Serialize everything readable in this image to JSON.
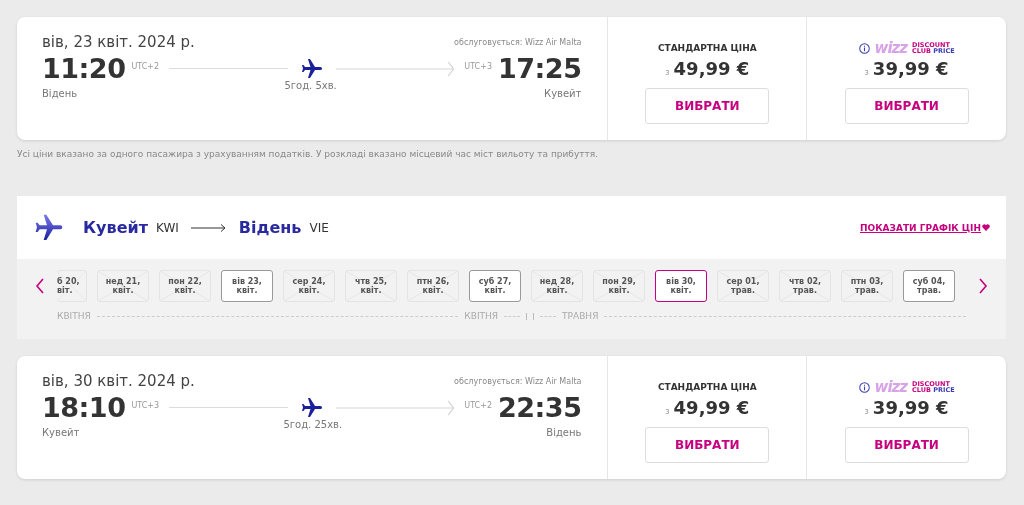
{
  "flights": [
    {
      "date": "вів, 23 квіт. 2024 р.",
      "operator": "обслуговується: Wizz Air Malta",
      "dep_time": "11:20",
      "dep_tz": "UTC+2",
      "dep_city": "Відень",
      "duration": "5год. 5хв.",
      "arr_tz": "UTC+3",
      "arr_time": "17:25",
      "arr_city": "Кувейт",
      "fares": [
        {
          "kind": "standard",
          "title": "СТАНДАРТНА ЦІНА",
          "from": "з",
          "price": "49,99 €",
          "button": "ВИБРАТИ"
        },
        {
          "kind": "club",
          "logo": "wizz",
          "title_1": "DISCOUNT",
          "title_2": "CLUB",
          "title_3": "PRICE",
          "from": "з",
          "price": "39,99 €",
          "button": "ВИБРАТИ"
        }
      ]
    },
    {
      "date": "вів, 30 квіт. 2024 р.",
      "operator": "обслуговується: Wizz Air Malta",
      "dep_time": "18:10",
      "dep_tz": "UTC+3",
      "dep_city": "Кувейт",
      "duration": "5год. 25хв.",
      "arr_tz": "UTC+2",
      "arr_time": "22:35",
      "arr_city": "Відень",
      "fares": [
        {
          "kind": "standard",
          "title": "СТАНДАРТНА ЦІНА",
          "from": "з",
          "price": "49,99 €",
          "button": "ВИБРАТИ"
        },
        {
          "kind": "club",
          "logo": "wizz",
          "title_1": "DISCOUNT",
          "title_2": "CLUB",
          "title_3": "PRICE",
          "from": "з",
          "price": "39,99 €",
          "button": "ВИБРАТИ"
        }
      ]
    }
  ],
  "note": "Усі ціни вказано за одного пасажира з урахуванням податків. У розкладі вказано місцевий час міст вильоту та прибуття.",
  "route": {
    "from_city": "Кувейт",
    "from_code": "KWI",
    "to_city": "Відень",
    "to_code": "VIE",
    "price_chart_link": "ПОКАЗАТИ ГРАФІК ЦІН"
  },
  "dates": [
    {
      "day": "б 20,",
      "month": "віт.",
      "available": false,
      "selected": false
    },
    {
      "day": "нед 21,",
      "month": "квіт.",
      "available": false,
      "selected": false
    },
    {
      "day": "пон 22,",
      "month": "квіт.",
      "available": false,
      "selected": false
    },
    {
      "day": "вів 23,",
      "month": "квіт.",
      "available": true,
      "selected": false
    },
    {
      "day": "сер 24,",
      "month": "квіт.",
      "available": false,
      "selected": false
    },
    {
      "day": "чтв 25,",
      "month": "квіт.",
      "available": false,
      "selected": false
    },
    {
      "day": "птн 26,",
      "month": "квіт.",
      "available": false,
      "selected": false
    },
    {
      "day": "суб 27,",
      "month": "квіт.",
      "available": true,
      "selected": false
    },
    {
      "day": "нед 28,",
      "month": "квіт.",
      "available": false,
      "selected": false
    },
    {
      "day": "пон 29,",
      "month": "квіт.",
      "available": false,
      "selected": false
    },
    {
      "day": "вів 30,",
      "month": "квіт.",
      "available": true,
      "selected": true
    },
    {
      "day": "сер 01,",
      "month": "трав.",
      "available": false,
      "selected": false
    },
    {
      "day": "чтв 02,",
      "month": "трав.",
      "available": false,
      "selected": false
    },
    {
      "day": "птн 03,",
      "month": "трав.",
      "available": false,
      "selected": false
    },
    {
      "day": "суб 04,",
      "month": "трав.",
      "available": true,
      "selected": false
    }
  ],
  "months": [
    "КВІТНЯ",
    "КВІТНЯ",
    "ТРАВНЯ"
  ]
}
